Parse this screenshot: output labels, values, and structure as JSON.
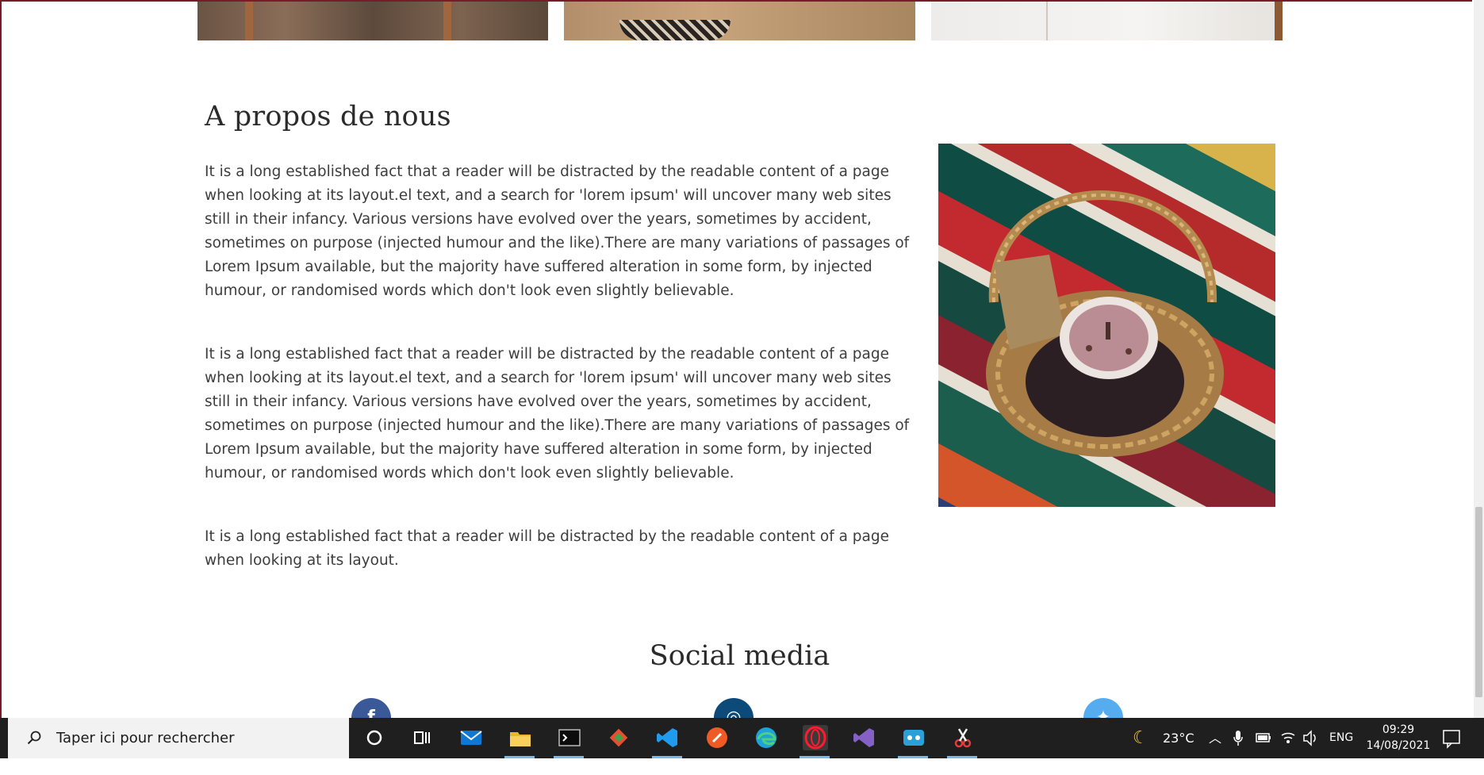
{
  "about": {
    "title": "A propos de nous",
    "paragraphs": [
      "It is a long established fact that a reader will be distracted by the readable content of a page when looking at its layout.el text, and a search for 'lorem ipsum' will uncover many web sites still in their infancy. Various versions have evolved over the years, sometimes by accident, sometimes on purpose (injected humour and the like).There are many variations of passages of Lorem Ipsum available, but the majority have suffered alteration in some form, by injected humour, or randomised words which don't look even slightly believable.",
      "It is a long established fact that a reader will be distracted by the readable content of a page when looking at its layout.el text, and a search for 'lorem ipsum' will uncover many web sites still in their infancy. Various versions have evolved over the years, sometimes by accident, sometimes on purpose (injected humour and the like).There are many variations of passages of Lorem Ipsum available, but the majority have suffered alteration in some form, by injected humour, or randomised words which don't look even slightly believable.",
      "It is a long established fact that a reader will be distracted by the readable content of a page when looking at its layout."
    ]
  },
  "social": {
    "title": "Social media",
    "facebook_glyph": "f",
    "instagram_glyph": "◎",
    "twitter_glyph": "✦"
  },
  "colors": {
    "facebook": "#3b5998",
    "instagram": "#0c4a7a",
    "twitter": "#55acee",
    "taskbar": "#1f1f1f"
  },
  "taskbar": {
    "search_placeholder": "Taper ici pour rechercher",
    "apps": [
      {
        "name": "cortana-icon"
      },
      {
        "name": "task-view-icon"
      },
      {
        "name": "mail-icon"
      },
      {
        "name": "file-explorer-icon"
      },
      {
        "name": "terminal-icon"
      },
      {
        "name": "git-icon"
      },
      {
        "name": "vscode-icon"
      },
      {
        "name": "postman-icon"
      },
      {
        "name": "edge-icon"
      },
      {
        "name": "opera-icon"
      },
      {
        "name": "visual-studio-icon"
      },
      {
        "name": "teams-icon"
      },
      {
        "name": "snip-tool-icon"
      }
    ],
    "weather": "23°C",
    "language": "ENG",
    "time": "09:29",
    "date": "14/08/2021"
  }
}
